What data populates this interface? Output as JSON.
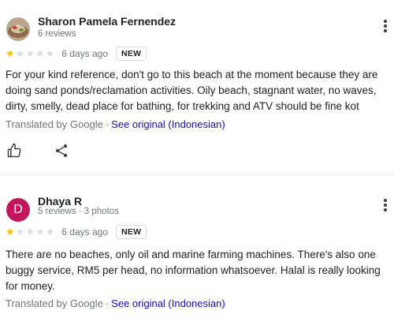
{
  "reviews": [
    {
      "author": "Sharon Pamela Fernendez",
      "meta": "6 reviews",
      "avatar_type": "photo",
      "rating": 1,
      "rating_max": 5,
      "date": "6 days ago",
      "badge": "NEW",
      "text": "For your kind reference, don't go to this beach at the moment because they are doing sand ponds/reclamation activities. Oily beach, stagnant water, no waves, dirty, smelly, dead place for bathing, for trekking and ATV should be fine kot",
      "translated_by": "Translated by Google",
      "separator": "·",
      "see_original": "See original (Indonesian)",
      "actions": [
        "like-icon",
        "share-icon"
      ]
    },
    {
      "author": "Dhaya R",
      "meta": "5 reviews · 3 photos",
      "avatar_letter": "D",
      "avatar_color": "#c2185b",
      "rating": 1,
      "rating_max": 5,
      "date": "6 days ago",
      "badge": "NEW",
      "text": "There are no beaches, only oil and marine farming machines. There's also one buggy service, RM5 per head, no information whatsoever. Halal is really looking for money.",
      "translated_by": "Translated by Google",
      "separator": "·",
      "see_original": "See original (Indonesian)"
    }
  ],
  "colors": {
    "star_on": "#fbbc04",
    "star_off": "#dadce0",
    "link": "#1a0dab",
    "secondary_text": "#70757a"
  }
}
